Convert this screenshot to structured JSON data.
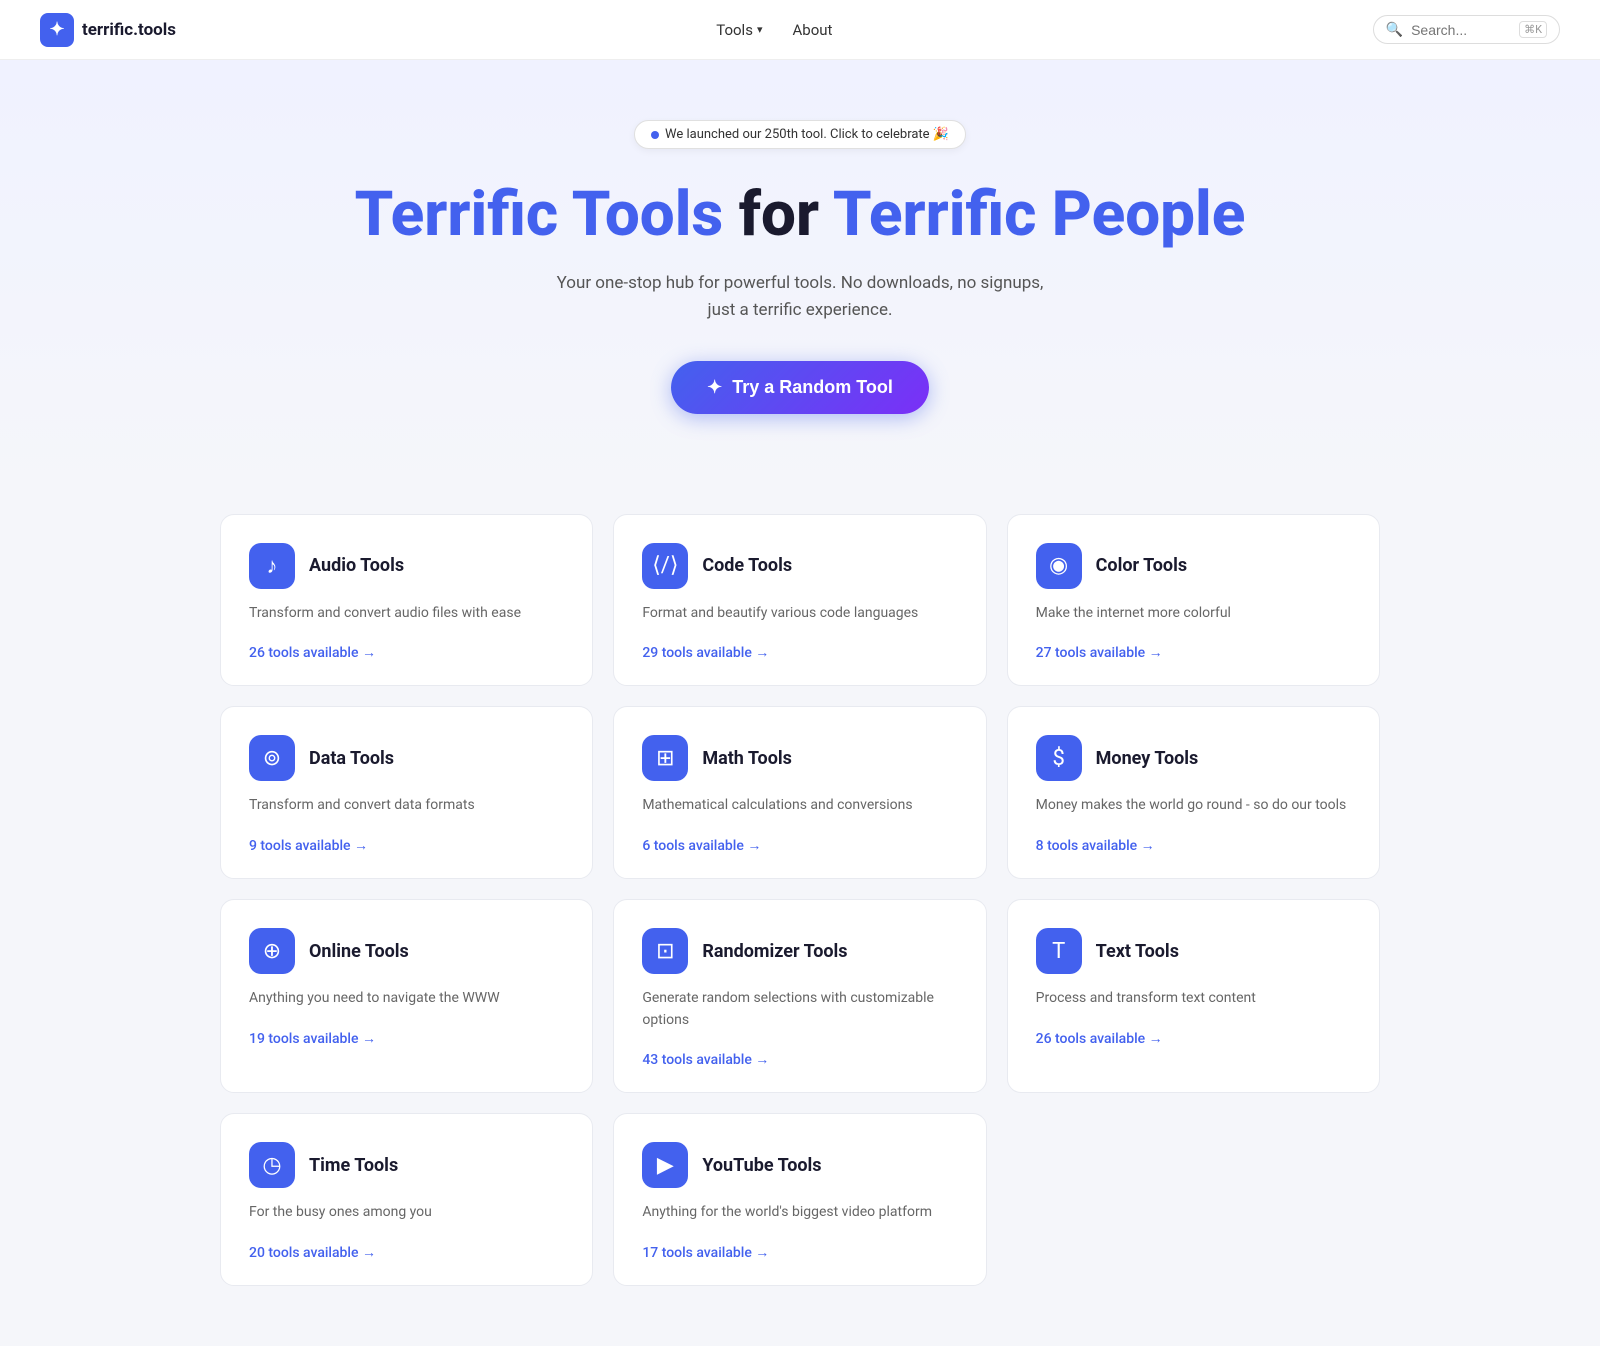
{
  "nav": {
    "logo_text": "terrific.tools",
    "logo_icon": "✦",
    "links": [
      {
        "label": "Tools",
        "has_chevron": true
      },
      {
        "label": "About",
        "has_chevron": false
      }
    ],
    "search_placeholder": "Search...",
    "search_shortcut": "⌘K"
  },
  "hero": {
    "announcement": "We launched our 250th tool. Click to celebrate 🎉",
    "title_blue1": "Terrific Tools",
    "title_black": "for",
    "title_blue2": "Terrific People",
    "subtitle": "Your one-stop hub for powerful tools. No downloads, no signups, just a terrific experience.",
    "cta_label": "Try a Random Tool",
    "cta_icon": "✦"
  },
  "tools": [
    {
      "id": "audio",
      "icon": "♪",
      "title": "Audio Tools",
      "desc": "Transform and convert audio files with ease",
      "count": "26 tools available →"
    },
    {
      "id": "code",
      "icon": "</>",
      "title": "Code Tools",
      "desc": "Format and beautify various code languages",
      "count": "29 tools available →"
    },
    {
      "id": "color",
      "icon": "🎨",
      "title": "Color Tools",
      "desc": "Make the internet more colorful",
      "count": "27 tools available →"
    },
    {
      "id": "data",
      "icon": "🗄",
      "title": "Data Tools",
      "desc": "Transform and convert data formats",
      "count": "9 tools available →"
    },
    {
      "id": "math",
      "icon": "🧮",
      "title": "Math Tools",
      "desc": "Mathematical calculations and conversions",
      "count": "6 tools available →"
    },
    {
      "id": "money",
      "icon": "$",
      "title": "Money Tools",
      "desc": "Money makes the world go round - so do our tools",
      "count": "8 tools available →"
    },
    {
      "id": "online",
      "icon": "🌐",
      "title": "Online Tools",
      "desc": "Anything you need to navigate the WWW",
      "count": "19 tools available →"
    },
    {
      "id": "randomizer",
      "icon": "⊡",
      "title": "Randomizer Tools",
      "desc": "Generate random selections with customizable options",
      "count": "43 tools available →"
    },
    {
      "id": "text",
      "icon": "T",
      "title": "Text Tools",
      "desc": "Process and transform text content",
      "count": "26 tools available →"
    },
    {
      "id": "time",
      "icon": "🕐",
      "title": "Time Tools",
      "desc": "For the busy ones among you",
      "count": "20 tools available →"
    },
    {
      "id": "youtube",
      "icon": "▶",
      "title": "YouTube Tools",
      "desc": "Anything for the world's biggest video platform",
      "count": "17 tools available →"
    }
  ]
}
